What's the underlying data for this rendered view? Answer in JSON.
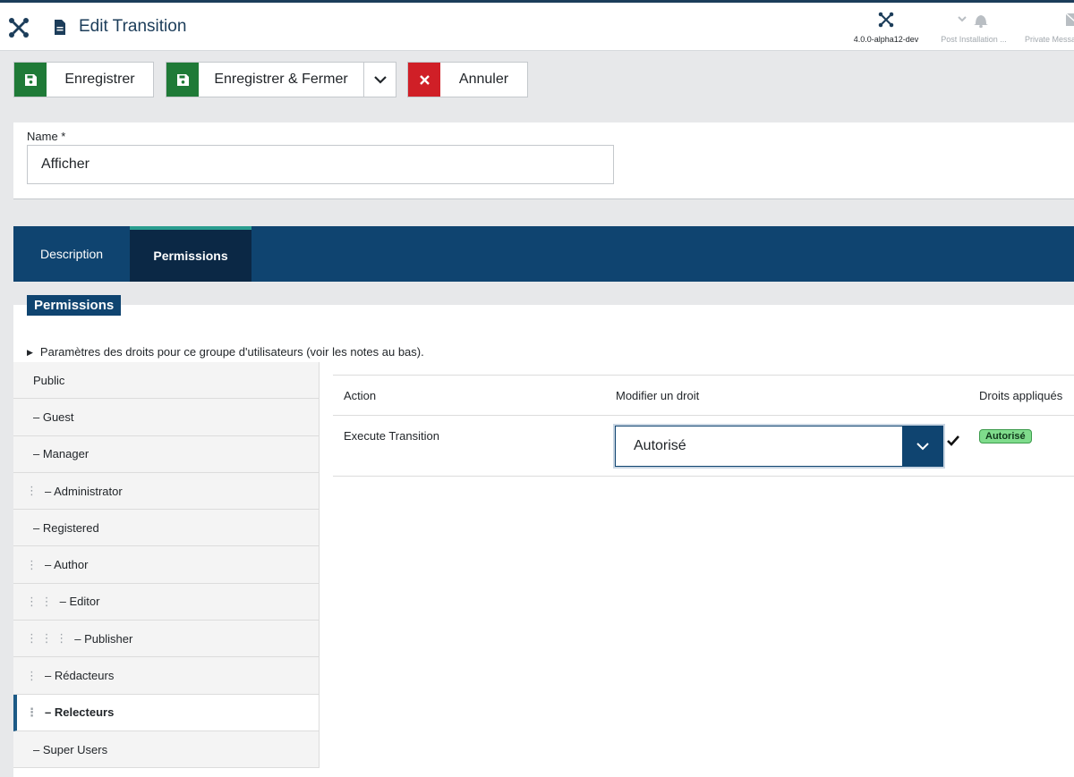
{
  "header": {
    "title": "Edit Transition",
    "version_label": "4.0.0-alpha12-dev",
    "post_install_label": "Post Installation ...",
    "private_messages_label": "Private Messa"
  },
  "toolbar": {
    "save_label": "Enregistrer",
    "save_close_label": "Enregistrer & Fermer",
    "cancel_label": "Annuler"
  },
  "form": {
    "name_label": "Name *",
    "name_value": "Afficher"
  },
  "tabs": [
    {
      "label": "Description",
      "active": false
    },
    {
      "label": "Permissions",
      "active": true
    }
  ],
  "permissions": {
    "legend": "Permissions",
    "summary": "Paramètres des droits pour ce groupe d'utilisateurs (voir les notes au bas).",
    "groups": [
      {
        "dots": "",
        "label": "Public"
      },
      {
        "dots": "",
        "label": "– Guest"
      },
      {
        "dots": "",
        "label": "– Manager"
      },
      {
        "dots": "⋮",
        "label": "– Administrator"
      },
      {
        "dots": "",
        "label": "– Registered"
      },
      {
        "dots": "⋮",
        "label": "– Author"
      },
      {
        "dots": "⋮ ⋮",
        "label": "– Editor"
      },
      {
        "dots": "⋮ ⋮ ⋮",
        "label": "– Publisher"
      },
      {
        "dots": "⋮",
        "label": "– Rédacteurs"
      },
      {
        "dots": "⋮",
        "label": "– Relecteurs"
      },
      {
        "dots": "",
        "label": "– Super Users"
      }
    ],
    "active_group_index": 9,
    "columns": {
      "action": "Action",
      "modify": "Modifier un droit",
      "applied": "Droits appliqués"
    },
    "rows": [
      {
        "action": "Execute Transition",
        "setting": "Autorisé",
        "applied": "Autorisé"
      }
    ]
  },
  "colors": {
    "brand_dark": "#1c3d5a",
    "tab_bar": "#0f4470",
    "save_green": "#1f7a37",
    "cancel_red": "#d01f27",
    "allowed_badge": "#7fdc8c"
  }
}
